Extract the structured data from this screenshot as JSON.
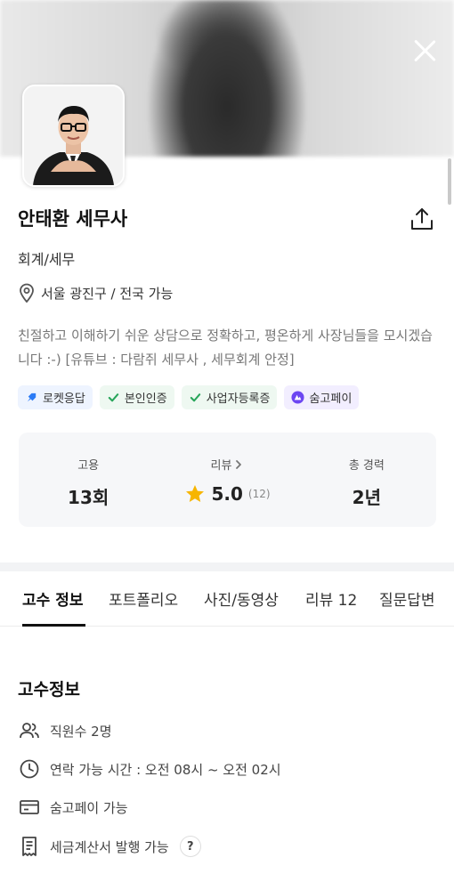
{
  "profile": {
    "name": "안태환 세무사",
    "category": "회계/세무",
    "location": "서울 광진구 / 전국 가능",
    "intro": "친절하고 이해하기 쉬운 상담으로 정확하고, 평온하게 사장님들을 모시겠습니다 :-)  [유튜브 : 다람쥐 세무사 , 세무회계 안정]"
  },
  "badges": [
    {
      "label": "로켓응답",
      "icon": "rocket-icon",
      "color": "#2b7bf5"
    },
    {
      "label": "본인인증",
      "icon": "check-icon",
      "color": "#27a55a"
    },
    {
      "label": "사업자등록증",
      "icon": "check-icon",
      "color": "#27a55a"
    },
    {
      "label": "숨고페이",
      "icon": "soomgo-pay-icon",
      "color": "#6c46f2"
    }
  ],
  "stats": {
    "hire_label": "고용",
    "hire_value": "13회",
    "review_label": "리뷰",
    "review_score": "5.0",
    "review_count": "(12)",
    "career_label": "총 경력",
    "career_value": "2년"
  },
  "tabs": [
    "고수 정보",
    "포트폴리오",
    "사진/동영상",
    "리뷰 12",
    "질문답변"
  ],
  "active_tab": "고수 정보",
  "info": {
    "title": "고수정보",
    "employees": "직원수 2명",
    "contact_hours": "연락 가능 시간 : 오전 08시  ~ 오전 02시",
    "payment": "숨고페이 가능",
    "tax_invoice": "세금계산서 발행 가능",
    "help_mark": "?"
  },
  "colors": {
    "star": "#f7b500",
    "tab_underline": "#111111",
    "stats_bg": "#f6f7f9"
  }
}
